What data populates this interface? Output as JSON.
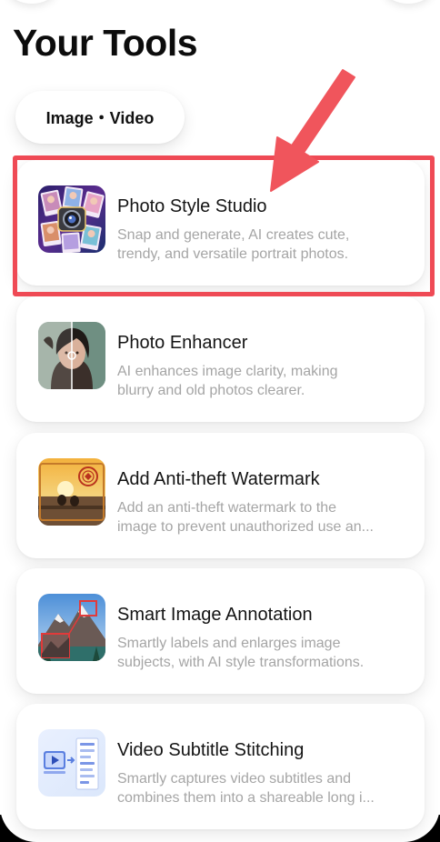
{
  "header": {
    "title": "Your Tools"
  },
  "filter_chip": {
    "label": "Image・Video"
  },
  "tools": [
    {
      "title": "Photo Style Studio",
      "desc_line1": "Snap and generate, AI creates cute,",
      "desc_line2": "trendy, and versatile portrait photos.",
      "icon": "photo-collage-camera-icon"
    },
    {
      "title": "Photo Enhancer",
      "desc_line1": "AI enhances image clarity, making",
      "desc_line2": "blurry and old photos clearer.",
      "icon": "portrait-before-after-icon"
    },
    {
      "title": "Add Anti-theft Watermark",
      "desc_line1": "Add an anti-theft watermark to the",
      "desc_line2": "image to prevent unauthorized use an...",
      "icon": "sunset-watermark-stamp-icon"
    },
    {
      "title": "Smart Image Annotation",
      "desc_line1": "Smartly labels and enlarges image",
      "desc_line2": "subjects, with AI style transformations.",
      "icon": "mountain-annotation-icon"
    },
    {
      "title": "Video Subtitle Stitching",
      "desc_line1": "Smartly captures video subtitles and",
      "desc_line2": "combines them into a shareable long i...",
      "icon": "video-to-document-icon"
    }
  ],
  "colors": {
    "highlight": "#ef4a55",
    "desc_text": "#a5a5a5",
    "title_text": "#141414"
  }
}
